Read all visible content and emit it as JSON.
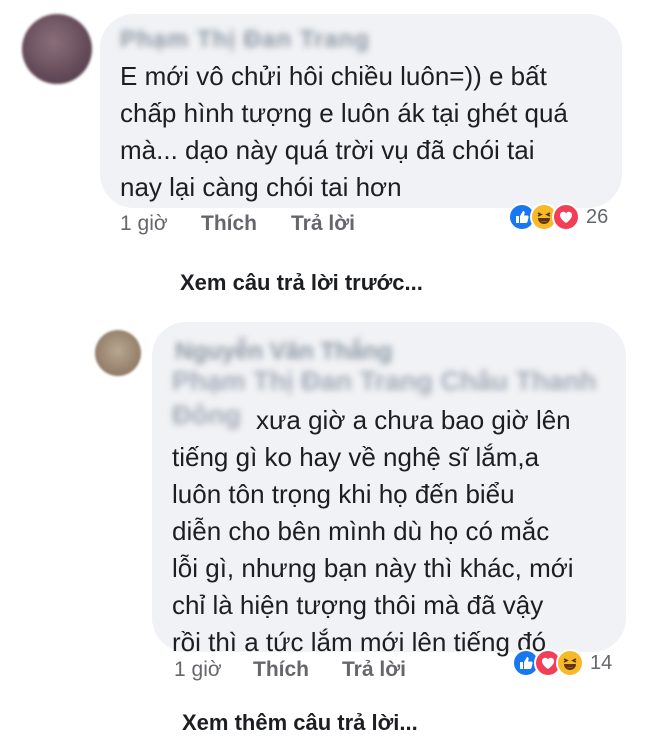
{
  "comment_1": {
    "author": "Phạm Thị Đan Trang",
    "lines": [
      "E mới vô chửi hôi chiều luôn=)) e bất",
      "chấp hình tượng e luôn ák tại ghét quá",
      "mà... dạo này quá trời vụ đã chói tai",
      "nay lại càng chói tai hơn"
    ],
    "time": "1 giờ",
    "like_label": "Thích",
    "reply_label": "Trả lời",
    "reaction_count": "26",
    "reactions": [
      "like",
      "haha",
      "love"
    ]
  },
  "view_previous_replies": "Xem câu trả lời trước...",
  "comment_2": {
    "author": "Nguyễn Văn Thắng",
    "tag_line_1": "Phạm Thị Đan Trang Châu Thanh",
    "tag_line_2": "Đông",
    "lines": [
      "xưa giờ a chưa bao giờ lên",
      "tiếng gì ko hay về nghệ sĩ lắm,a",
      "luôn tôn trọng khi họ đến biểu",
      "diễn cho bên mình dù họ có mắc",
      "lỗi gì, nhưng bạn này thì khác, mới",
      "chỉ là hiện tượng thôi mà đã vậy",
      "rồi thì a tức lắm mới lên tiếng đó"
    ],
    "time": "1 giờ",
    "like_label": "Thích",
    "reply_label": "Trả lời",
    "reaction_count": "14",
    "reactions": [
      "like",
      "love",
      "haha"
    ]
  },
  "view_more_replies": "Xem thêm câu trả lời...",
  "colors": {
    "bubble": "#f0f2f5",
    "like": "#1877f2",
    "love": "#f33e58",
    "haha": "#f7b928",
    "muted_text": "#65676b"
  }
}
